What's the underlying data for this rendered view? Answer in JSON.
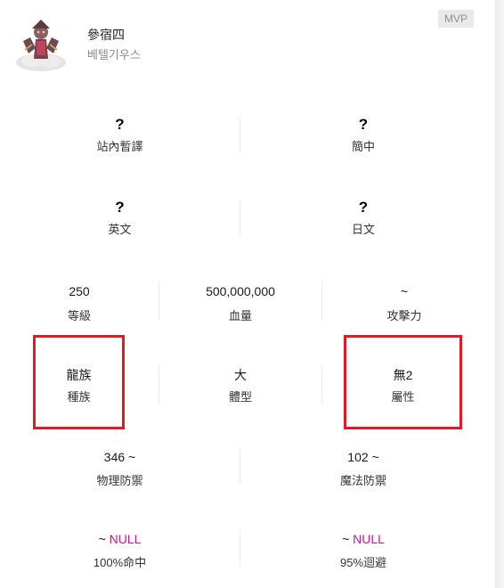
{
  "header": {
    "name": "參宿四",
    "subname": "베텔기우스",
    "badge": "MVP"
  },
  "rows": [
    [
      {
        "value": "?",
        "label": "站內暫譯"
      },
      {
        "value": "?",
        "label": "簡中"
      }
    ],
    [
      {
        "value": "?",
        "label": "英文"
      },
      {
        "value": "?",
        "label": "日文"
      }
    ],
    [
      {
        "value": "250",
        "label": "等級"
      },
      {
        "value": "500,000,000",
        "label": "血量"
      },
      {
        "value": "~",
        "label": "攻擊力"
      }
    ],
    [
      {
        "value": "龍族",
        "label": "種族"
      },
      {
        "value": "大",
        "label": "體型"
      },
      {
        "value": "無2",
        "label": "屬性"
      }
    ],
    [
      {
        "value": "346 ~",
        "label": "物理防禦"
      },
      {
        "value": "102 ~",
        "label": "魔法防禦"
      }
    ],
    [
      {
        "prefix": "~ ",
        "null_text": "NULL",
        "label": "100%命中"
      },
      {
        "prefix": "~ ",
        "null_text": "NULL",
        "label": "95%迴避"
      }
    ]
  ],
  "colors": {
    "null_accent": "#c2198e",
    "highlight_border": "#e01b23",
    "badge_bg": "#e9e9ea"
  }
}
